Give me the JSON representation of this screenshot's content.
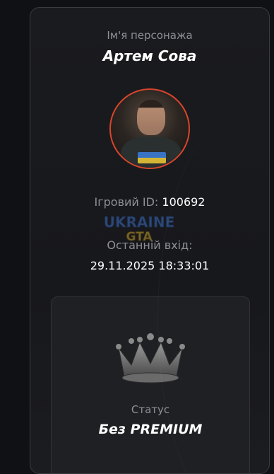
{
  "profile": {
    "name_label": "Ім'я персонажа",
    "name_value": "Артем Сова",
    "game_id_label": "Ігровий ID:",
    "game_id_value": "100692",
    "last_login_label": "Останній вхід:",
    "last_login_value": "29.11.2025 18:33:01"
  },
  "avatar": {
    "shirt_text": "UKRAINE GTA"
  },
  "watermark": {
    "line1": "UKRAINE",
    "line2": "GTA"
  },
  "status": {
    "icon": "crown-icon",
    "label": "Статус",
    "value": "Без PREMIUM"
  },
  "colors": {
    "background": "#101114",
    "card": "#1a1b1f",
    "avatar_ring": "#d9452b",
    "muted_text": "#8e9096",
    "primary_text": "#ffffff"
  }
}
